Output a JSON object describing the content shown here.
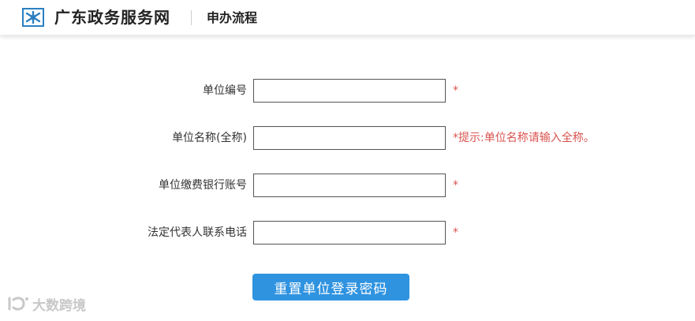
{
  "header": {
    "site_name": "广东政务服务网",
    "page_name": "申办流程"
  },
  "form": {
    "fields": [
      {
        "label": "单位编号",
        "value": "",
        "required_mark": "*"
      },
      {
        "label": "单位名称(全称)",
        "value": "",
        "required_mark": "*提示:单位名称请输入全称。"
      },
      {
        "label": "单位缴费银行账号",
        "value": "",
        "required_mark": "*"
      },
      {
        "label": "法定代表人联系电话",
        "value": "",
        "required_mark": "*"
      }
    ],
    "submit_label": "重置单位登录密码"
  },
  "watermark": {
    "text": "大数跨境"
  },
  "colors": {
    "brand_blue": "#2f93e0",
    "required_red": "#d9534f",
    "logo_blue": "#2b7fc1"
  },
  "icons": {
    "logo": "guangdong-gov-logo-icon",
    "watermark": "watermark-logo-icon"
  }
}
